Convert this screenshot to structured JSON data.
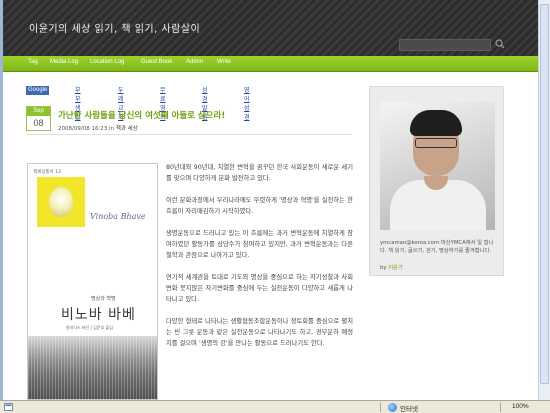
{
  "site": {
    "title": "이윤기의 세상 읽기, 책 읽기, 사람살이"
  },
  "search": {
    "placeholder": ""
  },
  "nav": {
    "items": [
      "Tag",
      "Media Log",
      "Location Log",
      "Guest Book",
      "Admin",
      "Write"
    ]
  },
  "adbar": {
    "badge": "Google 광고",
    "links": [
      "부부생활",
      "두레교회",
      "무료영화",
      "성경말씀",
      "영어성경"
    ]
  },
  "post": {
    "month": "Sep",
    "day": "08",
    "title": "가난한 사람들을 당신의 여섯째 아들로 삼으라!",
    "meta_time": "2008/09/08 16:23 in ",
    "meta_category": "책과 세상",
    "paragraphs": [
      "80년대와 90년대, 치열한 변혁을 꿈꾸던 한국 사회운동이 새로운 세기를 맞으며 다양하게 분화 발전하고 있다.",
      "이런 분화과정에서 우리나라에도 뚜렷하게 '명상과 혁명'을 실천하는 한 흐름이 자리매김하기 시작하였다.",
      "생명운동으로 드러나고 있는 이 흐름에는 과거 변혁운동에 치열하게 참여하였던 활동가를 상당수가 참여하고 있지만, 과거 변혁운동과는 다른 철학과 관점으로 나아가고 있다.",
      "연기적 세계관을 토대로 기도와 명상을 중심으로 하는 자기성찰과 사회변화 뭇지않은 자기변화를 중심에 두는 실천운동이 다양하고 새롭게 나타나고 있다.",
      "다양한 형태로 나타나는 생활협동조합운동이나 정토회를 중심으로 펼치는 빈 그릇 운동과 같은 실천운동으로 나타나기도 하고, 경부운하 예정지를 걸으며 '생명의 강'을 만나는 활동으로 드러나기도 한다."
    ]
  },
  "book": {
    "publisher": "책세상총서 13",
    "english": "Vinoba Bhave",
    "subtitle": "명상과 혁명",
    "title": "비노바 바베",
    "caption": "칼리다스 바잔 / 김문호 옮김"
  },
  "sidebar": {
    "profile_text": "ymcaman@korea.com 마산YMCA에서 일 합니다. 책 읽기, 글쓰기, 걷기, 명상하기를 즐겨합니다.",
    "by_prefix": "by ",
    "by_name": "이윤기"
  },
  "statusbar": {
    "zone": "인터넷",
    "zoom": "100%"
  },
  "colors": {
    "accent_green": "#8fc22a",
    "header_dark": "#333333",
    "title_green": "#6fa012"
  }
}
